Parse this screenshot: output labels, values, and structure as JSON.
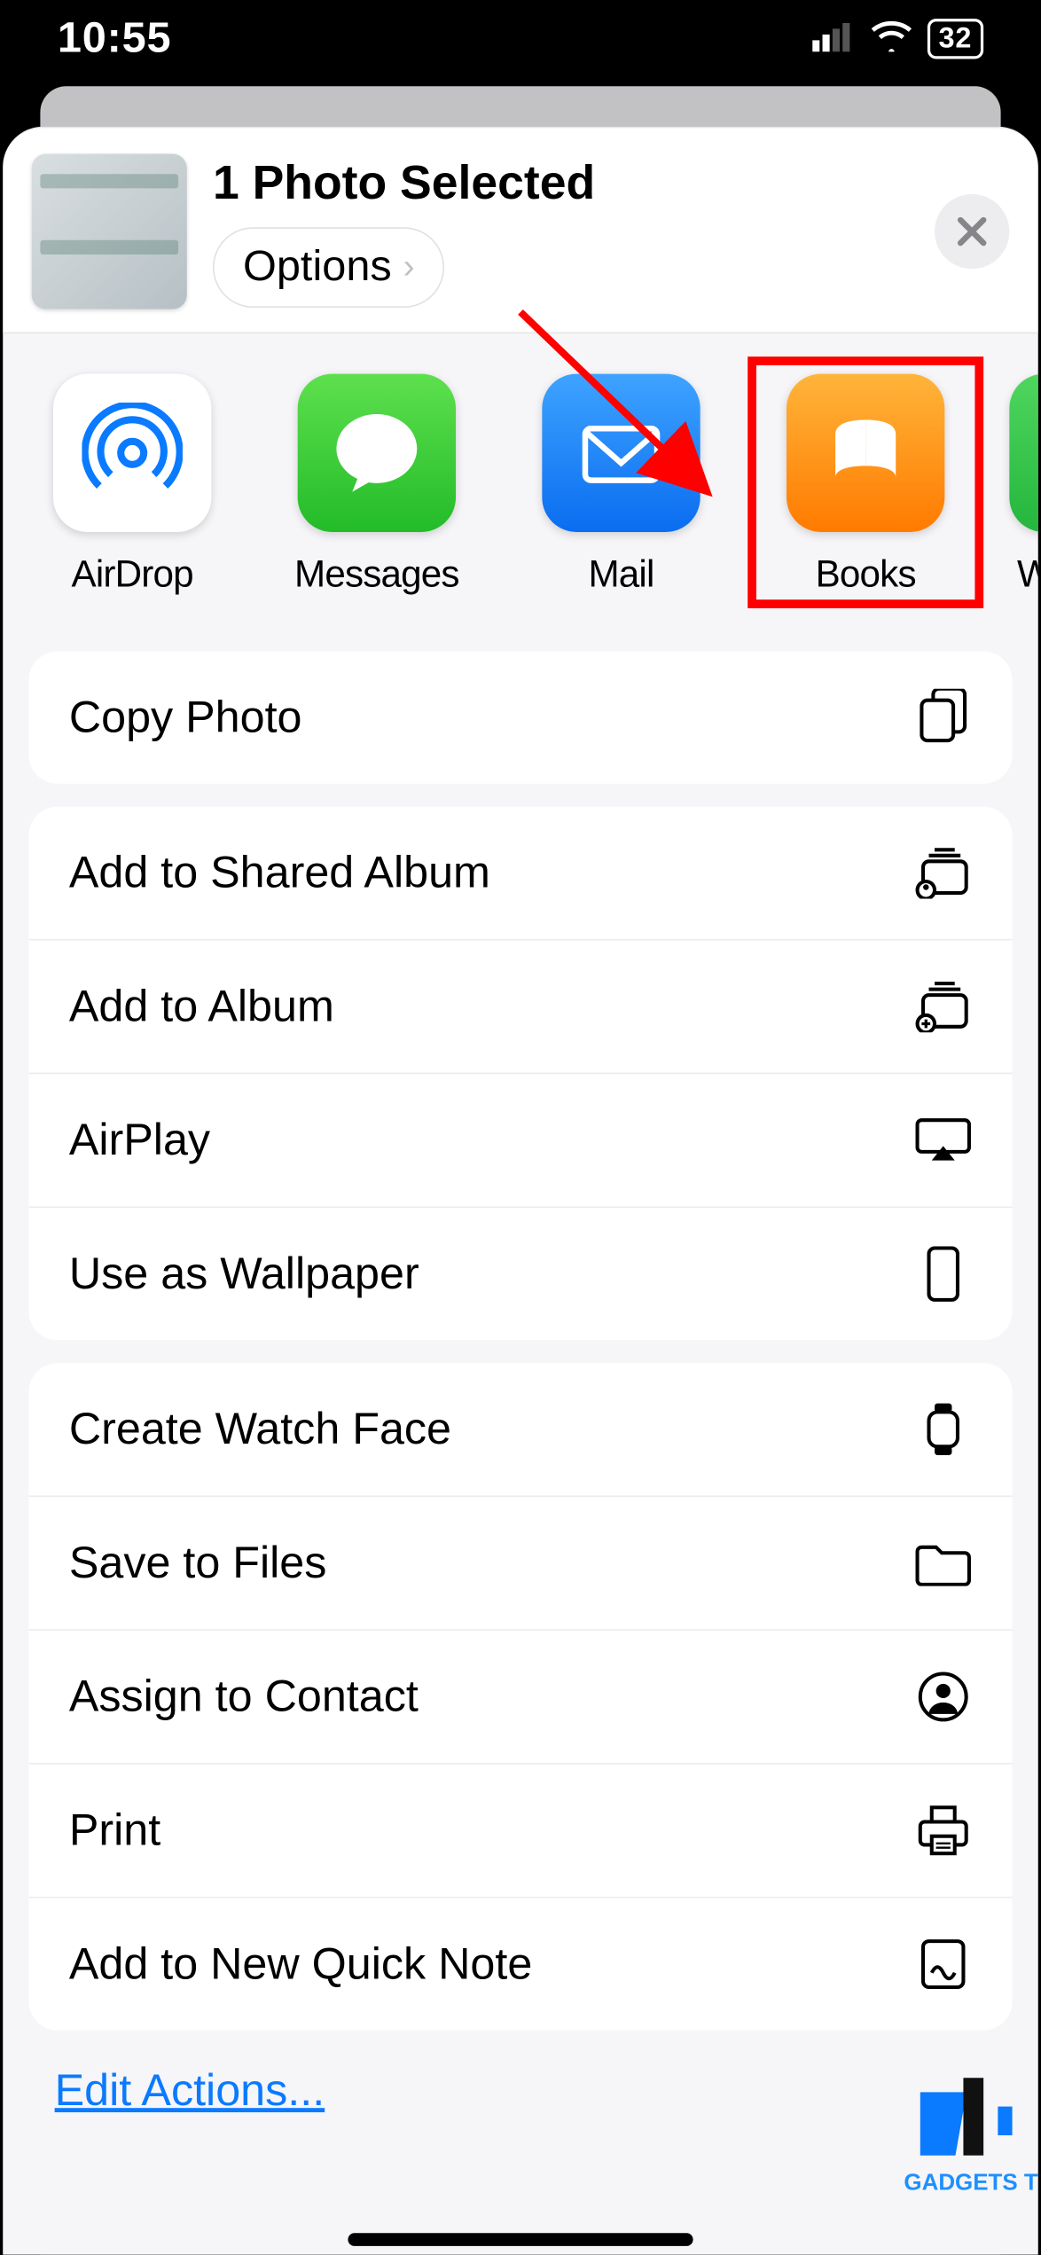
{
  "statusbar": {
    "time": "10:55",
    "battery_pct": "32"
  },
  "header": {
    "title": "1 Photo Selected",
    "options_label": "Options"
  },
  "apps": {
    "airdrop": "AirDrop",
    "messages": "Messages",
    "mail": "Mail",
    "books": "Books",
    "peek": "Wl"
  },
  "actions_group1": {
    "copy_photo": "Copy Photo"
  },
  "actions_group2": {
    "add_shared_album": "Add to Shared Album",
    "add_album": "Add to Album",
    "airplay": "AirPlay",
    "use_wallpaper": "Use as Wallpaper"
  },
  "actions_group3": {
    "create_watch_face": "Create Watch Face",
    "save_files": "Save to Files",
    "assign_contact": "Assign to Contact",
    "print": "Print",
    "add_quick_note": "Add to New Quick Note"
  },
  "footer": {
    "edit_actions": "Edit Actions..."
  },
  "watermark": {
    "text": "GADGETS T"
  }
}
